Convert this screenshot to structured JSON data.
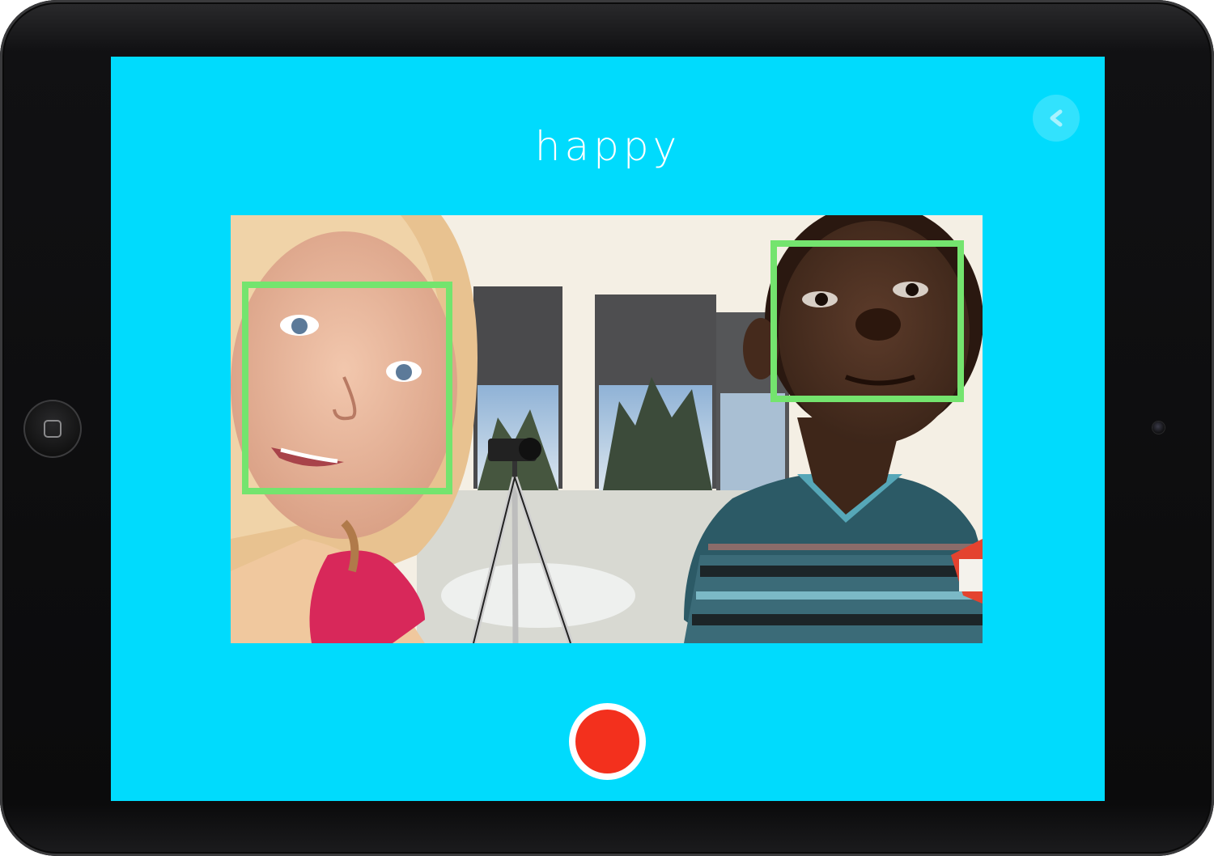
{
  "device": {
    "home_button_icon": "home-square-icon",
    "front_camera_icon": "camera-lens-icon"
  },
  "screen": {
    "background_color": "#00dbfd",
    "emotion_label": "happy",
    "back_button_icon": "chevron-left-icon",
    "record_button_icon": "record-dot-icon",
    "record_color": "#f3301d"
  },
  "camera_view": {
    "face_box_color": "#74e46e",
    "faces_detected": 2
  }
}
